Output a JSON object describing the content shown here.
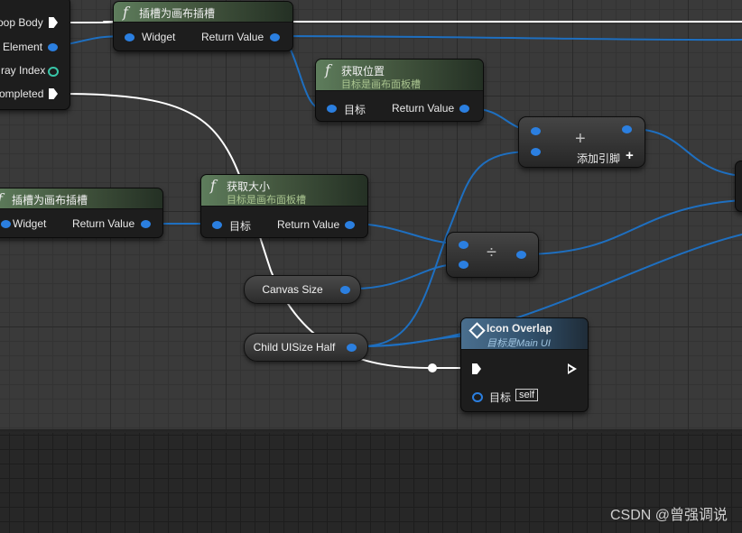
{
  "editor": {
    "left_stub": {
      "pins": [
        "oop Body",
        "Element",
        "ray Index",
        "ompleted"
      ]
    },
    "node_cast_top": {
      "title": "插槽为画布插槽",
      "pin_in": "Widget",
      "pin_out": "Return Value"
    },
    "node_get_position": {
      "title": "获取位置",
      "subtitle": "目标是画布面板槽",
      "pin_in": "目标",
      "pin_out": "Return Value"
    },
    "node_add": {
      "symbol": "+",
      "add_pin_label": "添加引脚"
    },
    "node_cast_left": {
      "title": "插槽为画布插槽",
      "pin_in": "Widget",
      "pin_out": "Return Value"
    },
    "node_get_size": {
      "title": "获取大小",
      "subtitle": "目标是画布面板槽",
      "pin_in": "目标",
      "pin_out": "Return Value"
    },
    "node_divide": {
      "symbol": "÷"
    },
    "var_canvas_size": {
      "label": "Canvas Size"
    },
    "var_child_half": {
      "label": "Child UISize Half"
    },
    "node_icon_overlap": {
      "title": "Icon Overlap",
      "subtitle": "目标是Main UI",
      "target_label": "目标",
      "target_value": "self"
    }
  },
  "colors": {
    "float_pin": "#2b7fe0",
    "exec_wire": "#ffffff",
    "data_wire": "#1e6fc0",
    "function_header": "#5e7d5c",
    "event_header": "#4a6f8e"
  },
  "watermark": "CSDN @曾强调说"
}
